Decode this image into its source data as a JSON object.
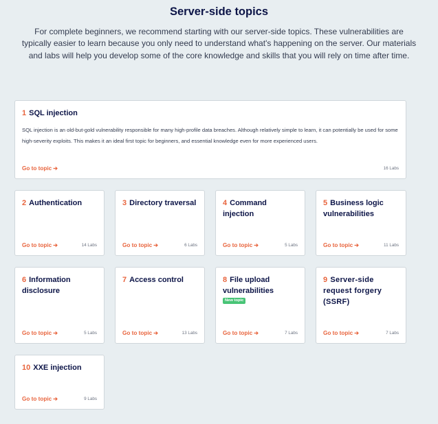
{
  "page": {
    "title": "Server-side topics",
    "intro": "For complete beginners, we recommend starting with our server-side topics. These vulnerabilities are typically easier to learn because you only need to understand what's happening on the server. Our materials and labs will help you develop some of the core knowledge and skills that you will rely on time after time."
  },
  "link_arrow_icon": "arrow-right-icon",
  "colors": {
    "accent": "#e8643d",
    "heading": "#0c1447",
    "background": "#e8eef1",
    "badge": "#48c476"
  },
  "topics": [
    {
      "num": "1",
      "title": "SQL injection",
      "description": "SQL injection is an old-but-gold vulnerability responsible for many high-profile data breaches. Although relatively simple to learn, it can potentially be used for some high-severity exploits. This makes it an ideal first topic for beginners, and essential knowledge even for more experienced users.",
      "link": "Go to topic",
      "labs": "16 Labs"
    },
    {
      "num": "2",
      "title": "Authentication",
      "link": "Go to topic",
      "labs": "14 Labs"
    },
    {
      "num": "3",
      "title": "Directory traversal",
      "link": "Go to topic",
      "labs": "6 Labs"
    },
    {
      "num": "4",
      "title": "Command injection",
      "link": "Go to topic",
      "labs": "5 Labs"
    },
    {
      "num": "5",
      "title": "Business logic vulnerabilities",
      "link": "Go to topic",
      "labs": "11 Labs"
    },
    {
      "num": "6",
      "title": "Information disclosure",
      "link": "Go to topic",
      "labs": "5 Labs"
    },
    {
      "num": "7",
      "title": "Access control",
      "link": "Go to topic",
      "labs": "13 Labs"
    },
    {
      "num": "8",
      "title": "File upload vulnerabilities",
      "badge": "New topic",
      "link": "Go to topic",
      "labs": "7 Labs"
    },
    {
      "num": "9",
      "title": "Server-side request forgery (SSRF)",
      "link": "Go to topic",
      "labs": "7 Labs"
    },
    {
      "num": "10",
      "title": "XXE injection",
      "link": "Go to topic",
      "labs": "9 Labs"
    }
  ]
}
